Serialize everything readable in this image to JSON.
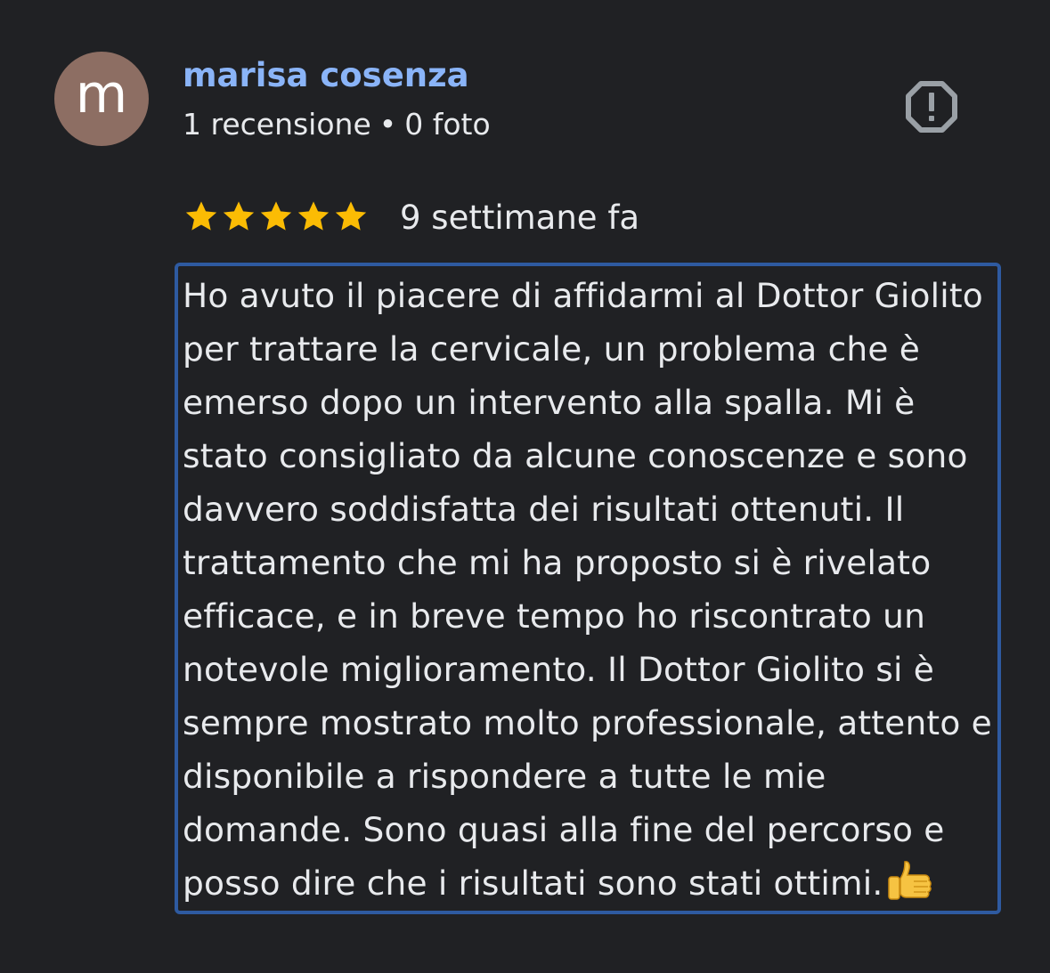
{
  "author": {
    "avatar_letter": "m",
    "avatar_color": "#8d6e63",
    "name": "marisa cosenza",
    "name_color": "#8ab4f8",
    "reviews_count": "1 recensione",
    "separator": "•",
    "photos_count": "0 foto"
  },
  "actions": {
    "report_icon": "report-flag-icon"
  },
  "rating": {
    "stars": 5,
    "max_stars": 5,
    "star_color": "#fbbc04",
    "date": "9 settimane fa"
  },
  "review": {
    "border_color": "#2e5aa0",
    "lines": [
      "Ho avuto il piacere di affidarmi al Dottor Giolito",
      "per trattare la cervicale, un problema che è",
      "emerso dopo un intervento alla spalla. Mi è",
      "stato consigliato da alcune conoscenze e sono",
      "davvero soddisfatta dei risultati ottenuti. Il",
      "trattamento che mi ha proposto si è rivelato",
      "efficace, e in breve tempo ho riscontrato un",
      "notevole miglioramento. Il Dottor Giolito si è",
      "sempre mostrato molto professionale, attento e",
      "disponibile a rispondere a tutte le mie",
      "domande. Sono quasi alla fine del percorso e",
      "posso dire che i risultati sono stati ottimi."
    ],
    "emoji": "thumbs-up-icon"
  }
}
